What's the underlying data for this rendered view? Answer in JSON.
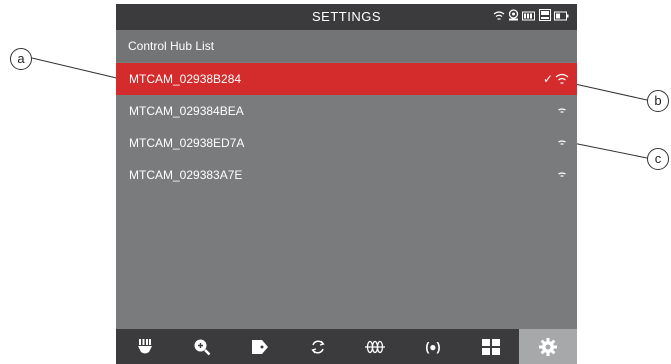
{
  "statusbar": {
    "title": "SETTINGS",
    "icons": [
      "wifi-icon",
      "camera-icon",
      "battery-icon",
      "storage-icon",
      "battery-level-icon"
    ]
  },
  "header": {
    "label": "Control Hub List"
  },
  "hubs": [
    {
      "name": "MTCAM_02938B284",
      "selected": true,
      "connected": true
    },
    {
      "name": "MTCAM_029384BEA",
      "selected": false,
      "connected": false
    },
    {
      "name": "MTCAM_02938ED7A",
      "selected": false,
      "connected": false
    },
    {
      "name": "MTCAM_029383A7E",
      "selected": false,
      "connected": false
    }
  ],
  "check_mark": "✓",
  "toolbar": {
    "items": [
      {
        "icon": "camera-head-icon"
      },
      {
        "icon": "zoom-icon"
      },
      {
        "icon": "tag-icon"
      },
      {
        "icon": "rotate-icon"
      },
      {
        "icon": "meter-icon"
      },
      {
        "icon": "sonde-icon",
        "label": "(●)"
      },
      {
        "icon": "grid-icon"
      },
      {
        "icon": "settings-gear-icon",
        "active": true
      }
    ]
  },
  "callouts": {
    "a": "a",
    "b": "b",
    "c": "c"
  },
  "colors": {
    "accent": "#d42c2c",
    "screen": "#7a7b7d",
    "bar": "#3b3b3d"
  }
}
